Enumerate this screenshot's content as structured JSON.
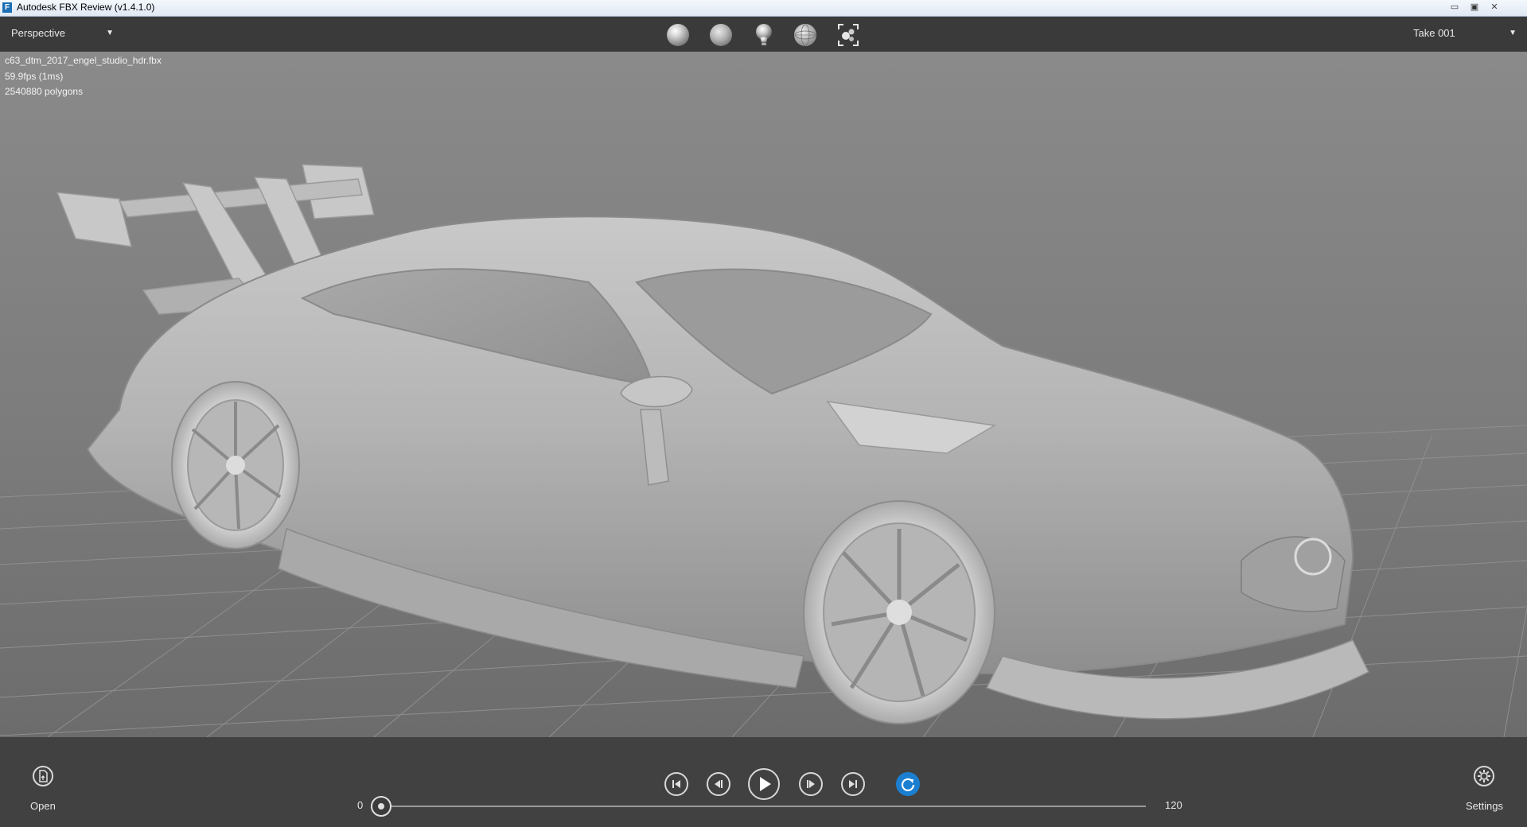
{
  "window": {
    "title": "Autodesk FBX Review (v1.4.1.0)",
    "app_icon_letter": "F"
  },
  "toolbar": {
    "view_mode": "Perspective",
    "take": "Take 001",
    "shading_buttons": [
      "shaded-sphere-icon",
      "matte-sphere-icon",
      "light-bulb-icon",
      "wireframe-sphere-icon",
      "frame-selection-icon"
    ]
  },
  "viewport": {
    "file_name": "c63_dtm_2017_engel_studio_hdr.fbx",
    "fps": "59.9fps (1ms)",
    "polygons": "2540880 polygons"
  },
  "playback": {
    "open_label": "Open",
    "settings_label": "Settings",
    "timeline_start": "0",
    "timeline_end": "120",
    "current_frame_fraction": 0,
    "loop_color": "#1b7fd1"
  }
}
